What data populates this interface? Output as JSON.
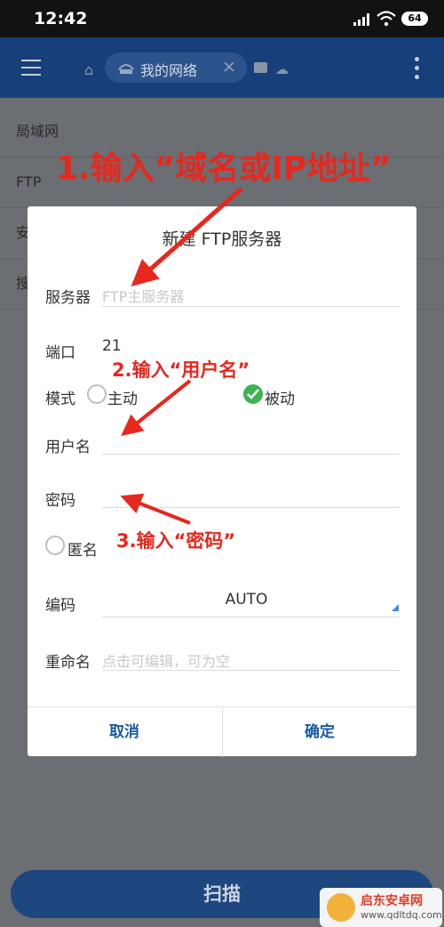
{
  "status_bar": {
    "time": "12:42",
    "battery": "64"
  },
  "app_bar": {
    "tab_label": "我的网络",
    "tab_close": "×"
  },
  "background_list": [
    "局域网",
    "FTP",
    "安",
    "搜"
  ],
  "annotations": {
    "step1": "1.输入“域名或IP地址”",
    "step2": "2.输入“用户名”",
    "step3": "3.输入“密码”",
    "color": "#e8271d"
  },
  "dialog": {
    "title": "新建 FTP服务器",
    "server_label": "服务器",
    "server_placeholder": "FTP主服务器",
    "port_label": "端口",
    "port_value": "21",
    "mode_label": "模式",
    "mode_active": "主动",
    "mode_passive": "被动",
    "mode_selected": "被动",
    "username_label": "用户名",
    "password_label": "密码",
    "anonymous_label": "匿名",
    "encoding_label": "编码",
    "encoding_value": "AUTO",
    "rename_label": "重命名",
    "rename_placeholder": "点击可编辑，可为空",
    "cancel_label": "取消",
    "ok_label": "确定"
  },
  "scan_button": "扫描",
  "watermark": {
    "name": "启东安卓网",
    "url": "www.qdltdq.com"
  },
  "colors": {
    "appbar": "#173f7a",
    "accent": "#1a5aa0",
    "check": "#3db353"
  }
}
